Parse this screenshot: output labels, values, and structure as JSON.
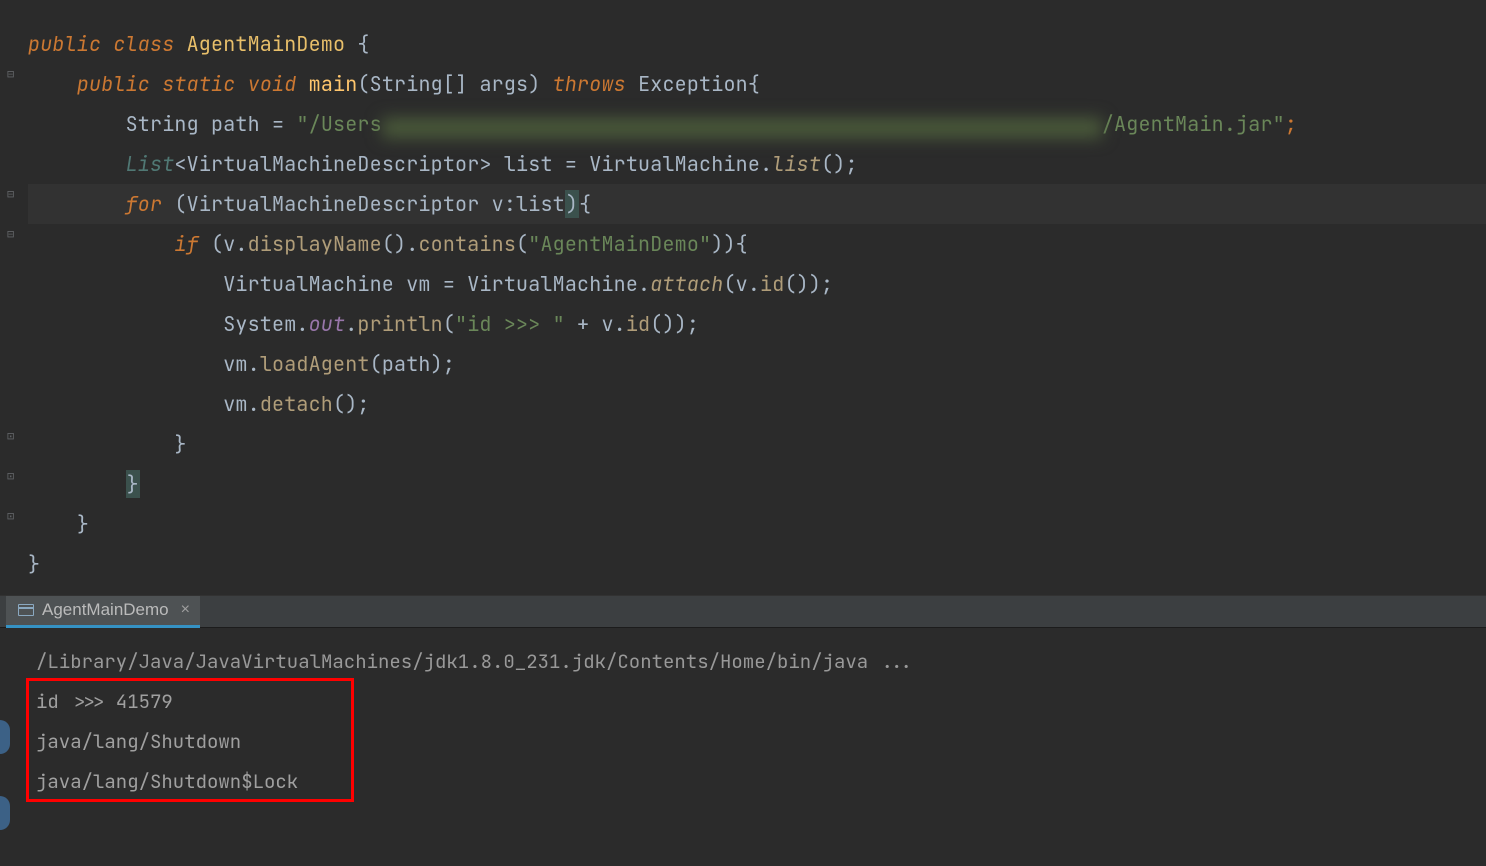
{
  "editor": {
    "lines": {
      "l1": {
        "public": "public",
        "class": "class",
        "name": "AgentMainDemo",
        "brace": "{"
      },
      "l2": {
        "public": "public",
        "static": "static",
        "void": "void",
        "main": "main",
        "params": "(String[] args)",
        "throws": "throws",
        "exc": "Exception",
        "brace": "{"
      },
      "l3": {
        "type": "String",
        "var": "path",
        "eq": " = ",
        "str1": "\"/Users",
        "blur": "xxxxxxxxxxxxxxxxxxxxxxxxxxxxxxxxxxxxxxxxxxxxxxxxxxxxxxxxxxxxxxxxxxxxxxxxxxxxxxxxxx",
        "str2": "/AgentMain.jar\"",
        "semi": ";"
      },
      "l4": {
        "list": "List",
        "lt": "<",
        "vmd": "VirtualMachineDescriptor",
        "gt": ">",
        "var": " list = ",
        "vm": "VirtualMachine",
        "dot": ".",
        "listcall": "list",
        "paren": "();"
      },
      "l5": {
        "for": "for",
        "open": " (",
        "vmd": "VirtualMachineDescriptor",
        "v": " v",
        "colon": ":",
        "list": "list",
        "close": ")",
        "brace": "{"
      },
      "l6": {
        "if": "if",
        "open": " (v.",
        "disp": "displayName",
        "p1": "().",
        "cont": "contains",
        "p2": "(",
        "str": "\"AgentMainDemo\"",
        "p3": ")){"
      },
      "l7": {
        "type": "VirtualMachine",
        "var": " vm = ",
        "cls": "VirtualMachine",
        "dot": ".",
        "attach": "attach",
        "p1": "(v.",
        "id": "id",
        "p2": "());"
      },
      "l8": {
        "sys": "System",
        "dot": ".",
        "out": "out",
        "dot2": ".",
        "println": "println",
        "open": "(",
        "str": "\"id >>> \"",
        "plus": " + v.",
        "id": "id",
        "close": "());"
      },
      "l9": {
        "vm": "vm.",
        "load": "loadAgent",
        "args": "(path);"
      },
      "l10": {
        "vm": "vm.",
        "detach": "detach",
        "args": "();"
      },
      "l11": {
        "brace": "}"
      },
      "l12": {
        "brace": "}"
      },
      "l13": {
        "brace": "}"
      },
      "l14": {
        "brace": "}"
      }
    }
  },
  "run_tab": {
    "label": "AgentMainDemo"
  },
  "console": {
    "cmd": "/Library/Java/JavaVirtualMachines/jdk1.8.0_231.jdk/Contents/Home/bin/java ...",
    "out1": "id >>> 41579",
    "out2": "java/lang/Shutdown",
    "out3": "java/lang/Shutdown$Lock"
  }
}
